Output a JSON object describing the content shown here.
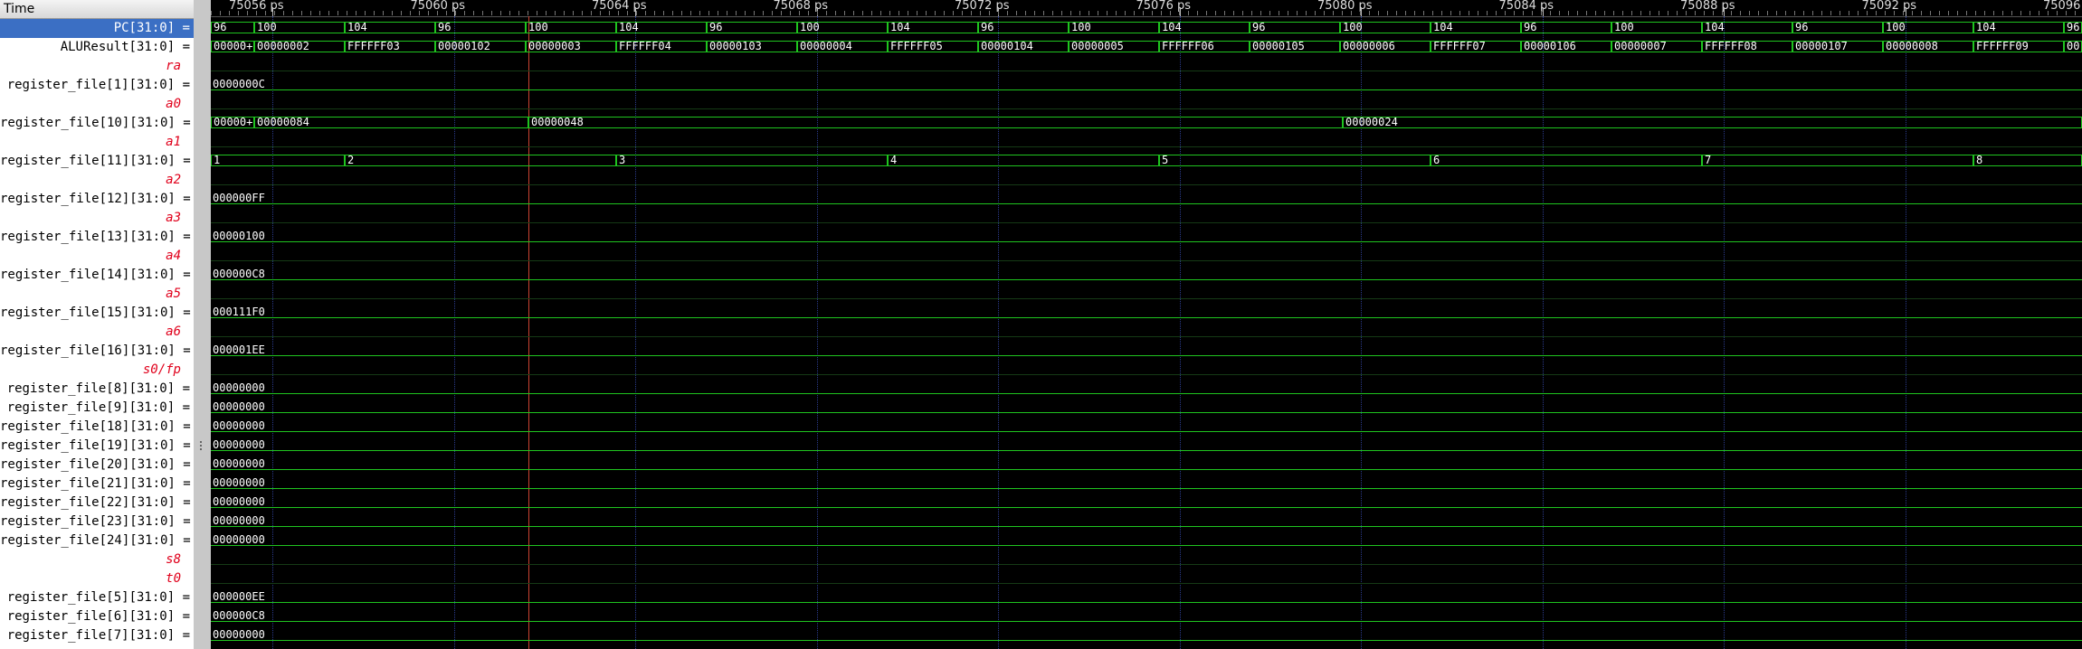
{
  "header": {
    "time_label": "Time"
  },
  "ruler": {
    "labels": [
      "75056 ps",
      "75060 ps",
      "75064 ps",
      "75068 ps",
      "75072 ps",
      "75076 ps",
      "75080 ps",
      "75084 ps",
      "75088 ps",
      "75092 ps",
      "75096"
    ]
  },
  "signals": [
    {
      "name": "PC[31:0] =",
      "selected": true,
      "kind": "bus",
      "segments": [
        "96",
        "100",
        "104",
        "96",
        "100",
        "104",
        "96",
        "100",
        "104",
        "96",
        "100",
        "104",
        "96",
        "100",
        "104",
        "96",
        "100",
        "104",
        "96",
        "100",
        "104",
        "96"
      ]
    },
    {
      "name": "ALUResult[31:0] =",
      "kind": "bus",
      "segments": [
        "00000+",
        "00000002",
        "FFFFFF03",
        "00000102",
        "00000003",
        "FFFFFF04",
        "00000103",
        "00000004",
        "FFFFFF05",
        "00000104",
        "00000005",
        "FFFFFF06",
        "00000105",
        "00000006",
        "FFFFFF07",
        "00000106",
        "00000007",
        "FFFFFF08",
        "00000107",
        "00000008",
        "FFFFFF09",
        "00"
      ]
    },
    {
      "name": "ra",
      "kind": "alias"
    },
    {
      "name": "register_file[1][31:0] =",
      "kind": "const",
      "value": "0000000C"
    },
    {
      "name": "a0",
      "kind": "alias"
    },
    {
      "name": "register_file[10][31:0] =",
      "kind": "bus",
      "segments": [
        "00000+",
        "00000084",
        "00000048",
        "00000024"
      ]
    },
    {
      "name": "a1",
      "kind": "alias"
    },
    {
      "name": "register_file[11][31:0] =",
      "kind": "bus",
      "segments": [
        "1",
        "2",
        "3",
        "4",
        "5",
        "6",
        "7",
        "8"
      ]
    },
    {
      "name": "a2",
      "kind": "alias"
    },
    {
      "name": "register_file[12][31:0] =",
      "kind": "const",
      "value": "000000FF"
    },
    {
      "name": "a3",
      "kind": "alias"
    },
    {
      "name": "register_file[13][31:0] =",
      "kind": "const",
      "value": "00000100"
    },
    {
      "name": "a4",
      "kind": "alias"
    },
    {
      "name": "register_file[14][31:0] =",
      "kind": "const",
      "value": "000000C8"
    },
    {
      "name": "a5",
      "kind": "alias"
    },
    {
      "name": "register_file[15][31:0] =",
      "kind": "const",
      "value": "000111F0"
    },
    {
      "name": "a6",
      "kind": "alias"
    },
    {
      "name": "register_file[16][31:0] =",
      "kind": "const",
      "value": "000001EE"
    },
    {
      "name": "s0/fp",
      "kind": "alias"
    },
    {
      "name": "register_file[8][31:0] =",
      "kind": "const",
      "value": "00000000"
    },
    {
      "name": "register_file[9][31:0] =",
      "kind": "const",
      "value": "00000000"
    },
    {
      "name": "register_file[18][31:0] =",
      "kind": "const",
      "value": "00000000"
    },
    {
      "name": "register_file[19][31:0] =",
      "kind": "const",
      "value": "00000000"
    },
    {
      "name": "register_file[20][31:0] =",
      "kind": "const",
      "value": "00000000"
    },
    {
      "name": "register_file[21][31:0] =",
      "kind": "const",
      "value": "00000000"
    },
    {
      "name": "register_file[22][31:0] =",
      "kind": "const",
      "value": "00000000"
    },
    {
      "name": "register_file[23][31:0] =",
      "kind": "const",
      "value": "00000000"
    },
    {
      "name": "register_file[24][31:0] =",
      "kind": "const",
      "value": "00000000"
    },
    {
      "name": "s8",
      "kind": "alias"
    },
    {
      "name": "t0",
      "kind": "alias"
    },
    {
      "name": "register_file[5][31:0] =",
      "kind": "const",
      "value": "000000EE"
    },
    {
      "name": "register_file[6][31:0] =",
      "kind": "const",
      "value": "000000C8"
    },
    {
      "name": "register_file[7][31:0] =",
      "kind": "const",
      "value": "00000000"
    }
  ],
  "colors": {
    "trace": "#1fc41f",
    "alias": "#e0001b",
    "selected": "#3b6fc4",
    "cursor": "#c43"
  }
}
